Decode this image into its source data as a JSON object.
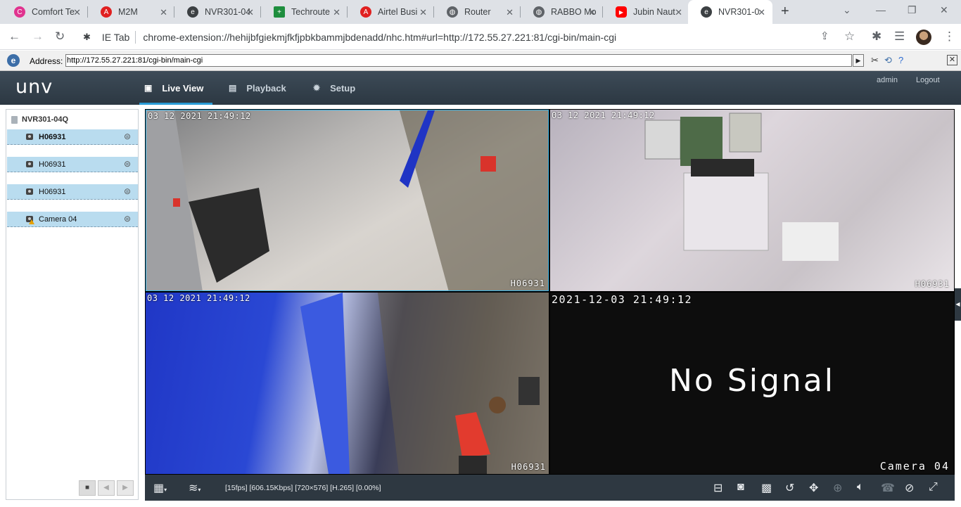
{
  "browser": {
    "tabs": [
      {
        "title": "Comfort Te",
        "fav_color": "#e0338f",
        "fav_glyph": "C"
      },
      {
        "title": "M2M",
        "fav_color": "#e02020",
        "fav_glyph": "A"
      },
      {
        "title": "NVR301-04",
        "fav_color": "#3c4043",
        "fav_glyph": "e"
      },
      {
        "title": "Techroute",
        "fav_color": "#1e8e3e",
        "fav_glyph": "+"
      },
      {
        "title": "Airtel Busi",
        "fav_color": "#e02020",
        "fav_glyph": "A"
      },
      {
        "title": "Router",
        "fav_color": "#5f6368",
        "fav_glyph": "◍"
      },
      {
        "title": "RABBO Mo",
        "fav_color": "#5f6368",
        "fav_glyph": "◍"
      },
      {
        "title": "Jubin Naut",
        "fav_color": "#ff0000",
        "fav_glyph": "▶"
      },
      {
        "title": "NVR301-0",
        "fav_color": "#3c4043",
        "fav_glyph": "e"
      }
    ],
    "address_chip": "IE Tab",
    "url": "chrome-extension://hehijbfgiekmjfkfjpbkbammjbdenadd/nhc.htm#url=http://172.55.27.221:81/cgi-bin/main-cgi"
  },
  "ie_bar": {
    "label": "Address:",
    "value": "http://172.55.27.221:81/cgi-bin/main-cgi"
  },
  "app": {
    "logo": "unv",
    "nav": [
      {
        "label": "Live View",
        "icon": "monitor-icon"
      },
      {
        "label": "Playback",
        "icon": "film-icon"
      },
      {
        "label": "Setup",
        "icon": "gear-icon"
      }
    ],
    "user": "admin",
    "logout": "Logout"
  },
  "device_tree": {
    "nvr": "NVR301-04Q",
    "cameras": [
      {
        "name": "H06931",
        "status": "online"
      },
      {
        "name": "H06931",
        "status": "online"
      },
      {
        "name": "H06931",
        "status": "online"
      },
      {
        "name": "Camera 04",
        "status": "warning"
      }
    ]
  },
  "video": {
    "panes": [
      {
        "timestamp": "03 12 2021  21:49:12",
        "camera_name": "H06931"
      },
      {
        "timestamp": "03 12 2021  21:49:12",
        "camera_name": "H06931"
      },
      {
        "timestamp": "03 12 2021  21:49:12",
        "camera_name": "H06931"
      },
      {
        "timestamp": "2021-12-03  21:49:12",
        "camera_name": "Camera 04",
        "message": "No  Signal"
      }
    ]
  },
  "status_bar": {
    "stream_info": "[15fps] [606.15Kbps] [720×576] [H.265] [0.00%]"
  }
}
